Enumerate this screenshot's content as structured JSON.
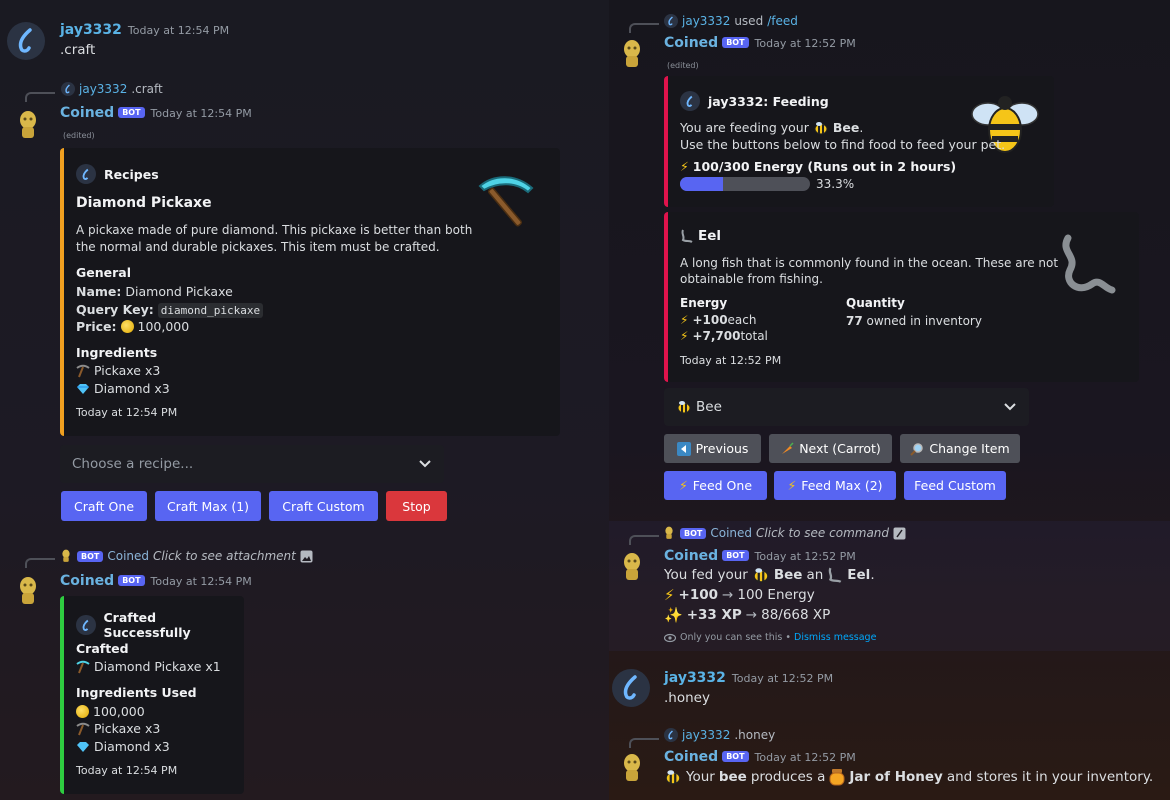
{
  "left": {
    "msg1": {
      "author": "jay3332",
      "timestamp": "Today at 12:54 PM",
      "text": ".craft"
    },
    "msg2": {
      "reply_author": "jay3332",
      "reply_text": ".craft",
      "author": "Coined",
      "badge": "BOT",
      "timestamp": "Today at 12:54 PM",
      "edited": "(edited)",
      "embed": {
        "author": "Recipes",
        "title": "Diamond Pickaxe",
        "description_line1": "A pickaxe made of pure diamond. This pickaxe is better than both",
        "description_line2": "the normal and durable pickaxes. This item must be crafted.",
        "general_title": "General",
        "name_label": "Name:",
        "name_value": " Diamond Pickaxe",
        "query_label": "Query Key:",
        "query_value": "diamond_pickaxe",
        "price_label": "Price:",
        "price_value": "100,000",
        "ingredients_title": "Ingredients",
        "ingredient1": "Pickaxe x3",
        "ingredient2": "Diamond x3",
        "footer": "Today at 12:54 PM"
      },
      "select_placeholder": "Choose a recipe...",
      "buttons": [
        "Craft One",
        "Craft Max (1)",
        "Craft Custom",
        "Stop"
      ]
    },
    "msg3": {
      "reply_badge": "BOT",
      "reply_author": "Coined",
      "reply_text": "Click to see attachment",
      "author": "Coined",
      "badge": "BOT",
      "timestamp": "Today at 12:54 PM",
      "embed": {
        "author": "Crafted Successfully",
        "crafted_title": "Crafted",
        "crafted_value": "Diamond Pickaxe x1",
        "used_title": "Ingredients Used",
        "used1": "100,000",
        "used2": "Pickaxe x3",
        "used3": "Diamond x3",
        "footer": "Today at 12:54 PM"
      }
    }
  },
  "right": {
    "msg1": {
      "reply_author": "jay3332",
      "reply_used": "used",
      "reply_command": "/feed",
      "author": "Coined",
      "badge": "BOT",
      "timestamp": "Today at 12:52 PM",
      "edited": "(edited)",
      "embed1": {
        "author": "jay3332: Feeding",
        "line1_prefix": "You are feeding your",
        "line1_pet": "Bee",
        "line1_suffix": ".",
        "line2": "Use the buttons below to find food to feed your pet.",
        "energy": "100/300 Energy (Runs out",
        "energy_in": "in 2 hours",
        "energy_close": ")",
        "progress_percent": 33.3,
        "progress_label": "33.3%"
      },
      "embed2": {
        "title": "Eel",
        "desc1": "A long fish that is commonly found in the ocean. These are not",
        "desc2": "obtainable from fishing.",
        "energy_title": "Energy",
        "energy_each_value": "+100",
        "energy_each_suffix": " each",
        "energy_total_value": "+7,700",
        "energy_total_suffix": " total",
        "qty_title": "Quantity",
        "qty_value": "77",
        "qty_suffix": " owned in inventory",
        "footer": "Today at 12:52 PM"
      },
      "select_value": "Bee",
      "row1": [
        "Previous",
        "Next (Carrot)",
        "Change Item"
      ],
      "row2": [
        "Feed One",
        "Feed Max (2)",
        "Feed Custom"
      ]
    },
    "msg2": {
      "reply_badge": "BOT",
      "reply_author": "Coined",
      "reply_text": "Click to see command",
      "author": "Coined",
      "badge": "BOT",
      "timestamp": "Today at 12:52 PM",
      "fed_prefix": "You fed your",
      "fed_pet": "Bee",
      "fed_mid": "an",
      "fed_food": "Eel",
      "fed_end": ".",
      "energy_gain": "+100",
      "energy_result": "100 Energy",
      "xp_gain": "+33 XP",
      "xp_result": "88/668 XP",
      "ephemeral": "Only you can see this",
      "ephemeral_sep": " • ",
      "dismiss": "Dismiss message"
    },
    "msg3": {
      "author": "jay3332",
      "timestamp": "Today at 12:52 PM",
      "text": ".honey"
    },
    "msg4": {
      "reply_author": "jay3332",
      "reply_text": ".honey",
      "author": "Coined",
      "badge": "BOT",
      "timestamp": "Today at 12:52 PM",
      "text_prefix": "Your",
      "text_pet": "bee",
      "text_mid": "produces a",
      "text_item": "Jar of Honey",
      "text_end": "and stores it in your inventory."
    }
  },
  "colors": {
    "blurple": "#5865f2",
    "grey_button": "#4e5058",
    "red_button": "#da373c",
    "embed_bar_orange": "#f0a020",
    "embed_bar_green": "#2ecc40",
    "embed_bar_red": "#e0134c"
  }
}
